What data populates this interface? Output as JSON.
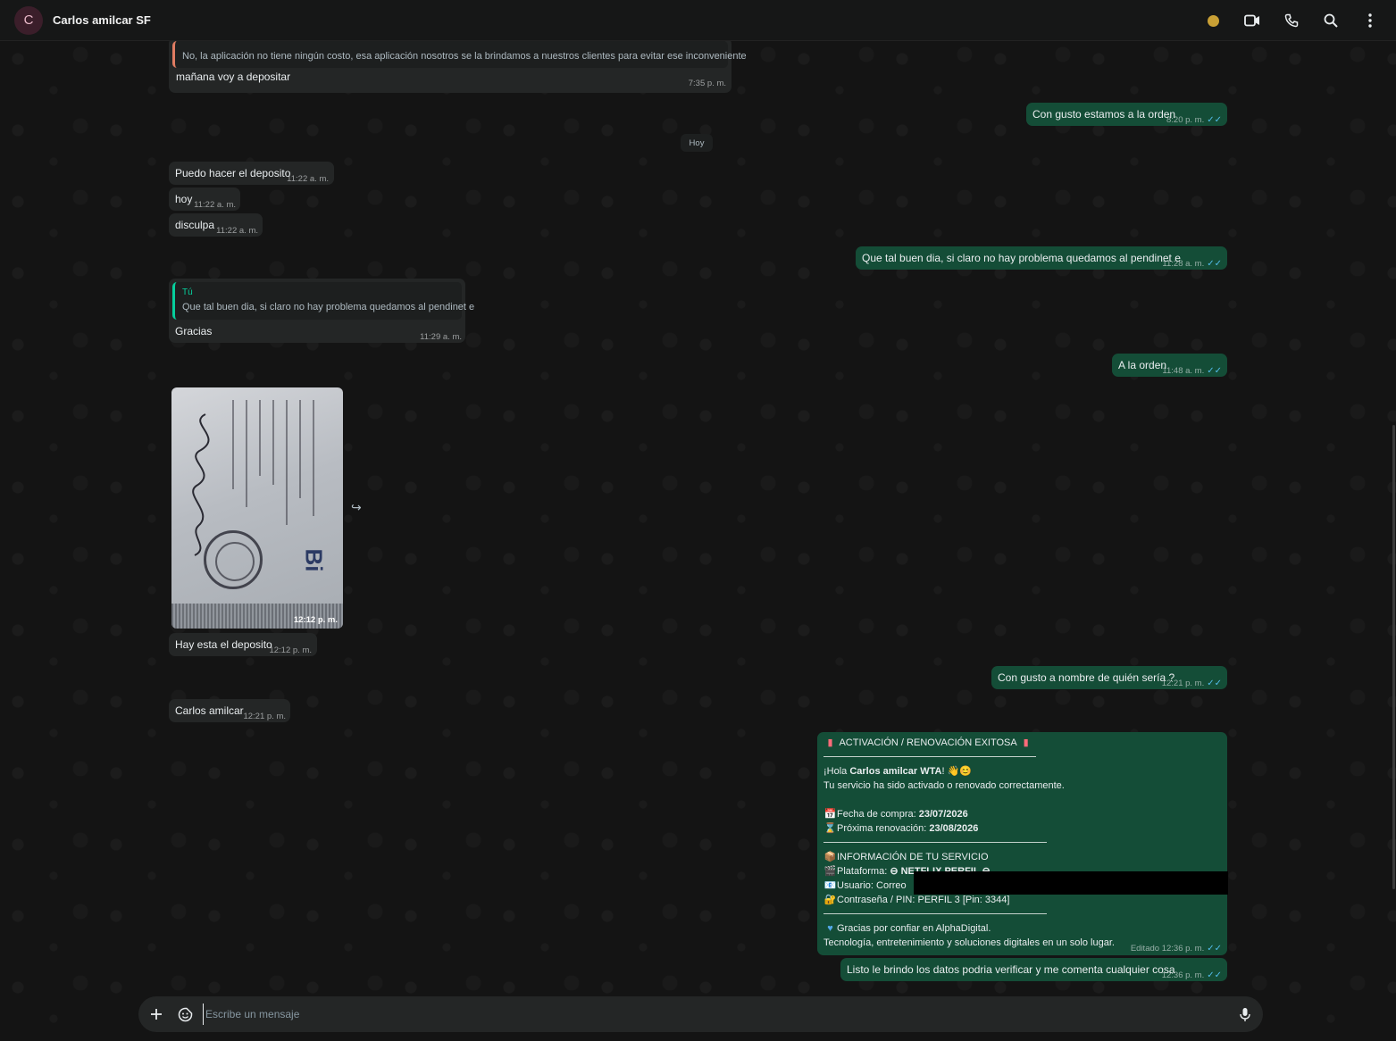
{
  "header": {
    "avatar_letter": "C",
    "contact_name": "Carlos amilcar SF",
    "status_dot_color": "#c9a035",
    "icons": [
      "video-icon",
      "phone-icon",
      "search-icon",
      "menu-icon"
    ]
  },
  "chat": {
    "day_divider": "Hoy",
    "messages": [
      {
        "quote_author": "",
        "quote_text": "No, la aplicación no tiene ningún costo, esa aplicación nosotros se la brindamos a nuestros clientes para evitar ese inconveniente",
        "text": "mañana voy a depositar",
        "time": "7:35 p. m."
      },
      {
        "text": "Con gusto estamos a la orden",
        "time": "8:20 p. m."
      },
      {
        "text": "Puedo hacer el deposito",
        "time": "11:22 a. m."
      },
      {
        "text": "hoy",
        "time": "11:22 a. m."
      },
      {
        "text": "disculpa",
        "time": "11:22 a. m."
      },
      {
        "text": "Que tal buen dia, si claro no hay problema quedamos al pendinet e",
        "time": "11:28 a. m."
      },
      {
        "quote_author": "Tú",
        "quote_text": "Que tal buen dia, si claro no hay problema quedamos al pendinet e",
        "text": "Gracias",
        "time": "11:29 a. m."
      },
      {
        "text": "A la orden",
        "time": "11:48 a. m."
      },
      {
        "photo_time": "12:12 p. m.",
        "photo_logo": "Bi"
      },
      {
        "text": "Hay esta el deposito",
        "time": "12:12 p. m."
      },
      {
        "text": "Con gusto a nombre de quién sería ?",
        "time": "12:21 p. m."
      },
      {
        "text": "Carlos amilcar",
        "time": "12:21 p. m."
      },
      {
        "card": {
          "title": "ACTIVACIÓN / RENOVACIÓN EXITOSA",
          "greeting_prefix": "¡Hola ",
          "greeting_name": "Carlos amilcar WTA",
          "greeting_suffix": "! 👋😊",
          "line_activated": "Tu servicio ha sido activado o renovado correctamente.",
          "purchase_label": "Fecha de compra: ",
          "purchase_date": "23/07/2026",
          "renewal_label": "Próxima renovación: ",
          "renewal_date": "23/08/2026",
          "info_title": "INFORMACIÓN DE TU SERVICIO",
          "platform_label": "Plataforma: ",
          "platform_value": "⊖ NETFLIX PERFIL ⊖",
          "user_label": "Usuario: Correo",
          "password_label": "Contraseña / PIN: PERFIL 3 [Pin: 3344]",
          "thanks": "Gracias por confiar en AlphaDigital.",
          "tagline": "Tecnología, entretenimiento y soluciones digitales en un solo lugar."
        },
        "edited_label": "Editado",
        "time": "12:36 p. m."
      },
      {
        "text": "Listo le brindo los datos podria verificar y me comenta cualquier cosa",
        "time": "12:36 p. m."
      }
    ],
    "read_ticks": "✓✓"
  },
  "composer": {
    "placeholder": "Escribe un mensaje"
  }
}
